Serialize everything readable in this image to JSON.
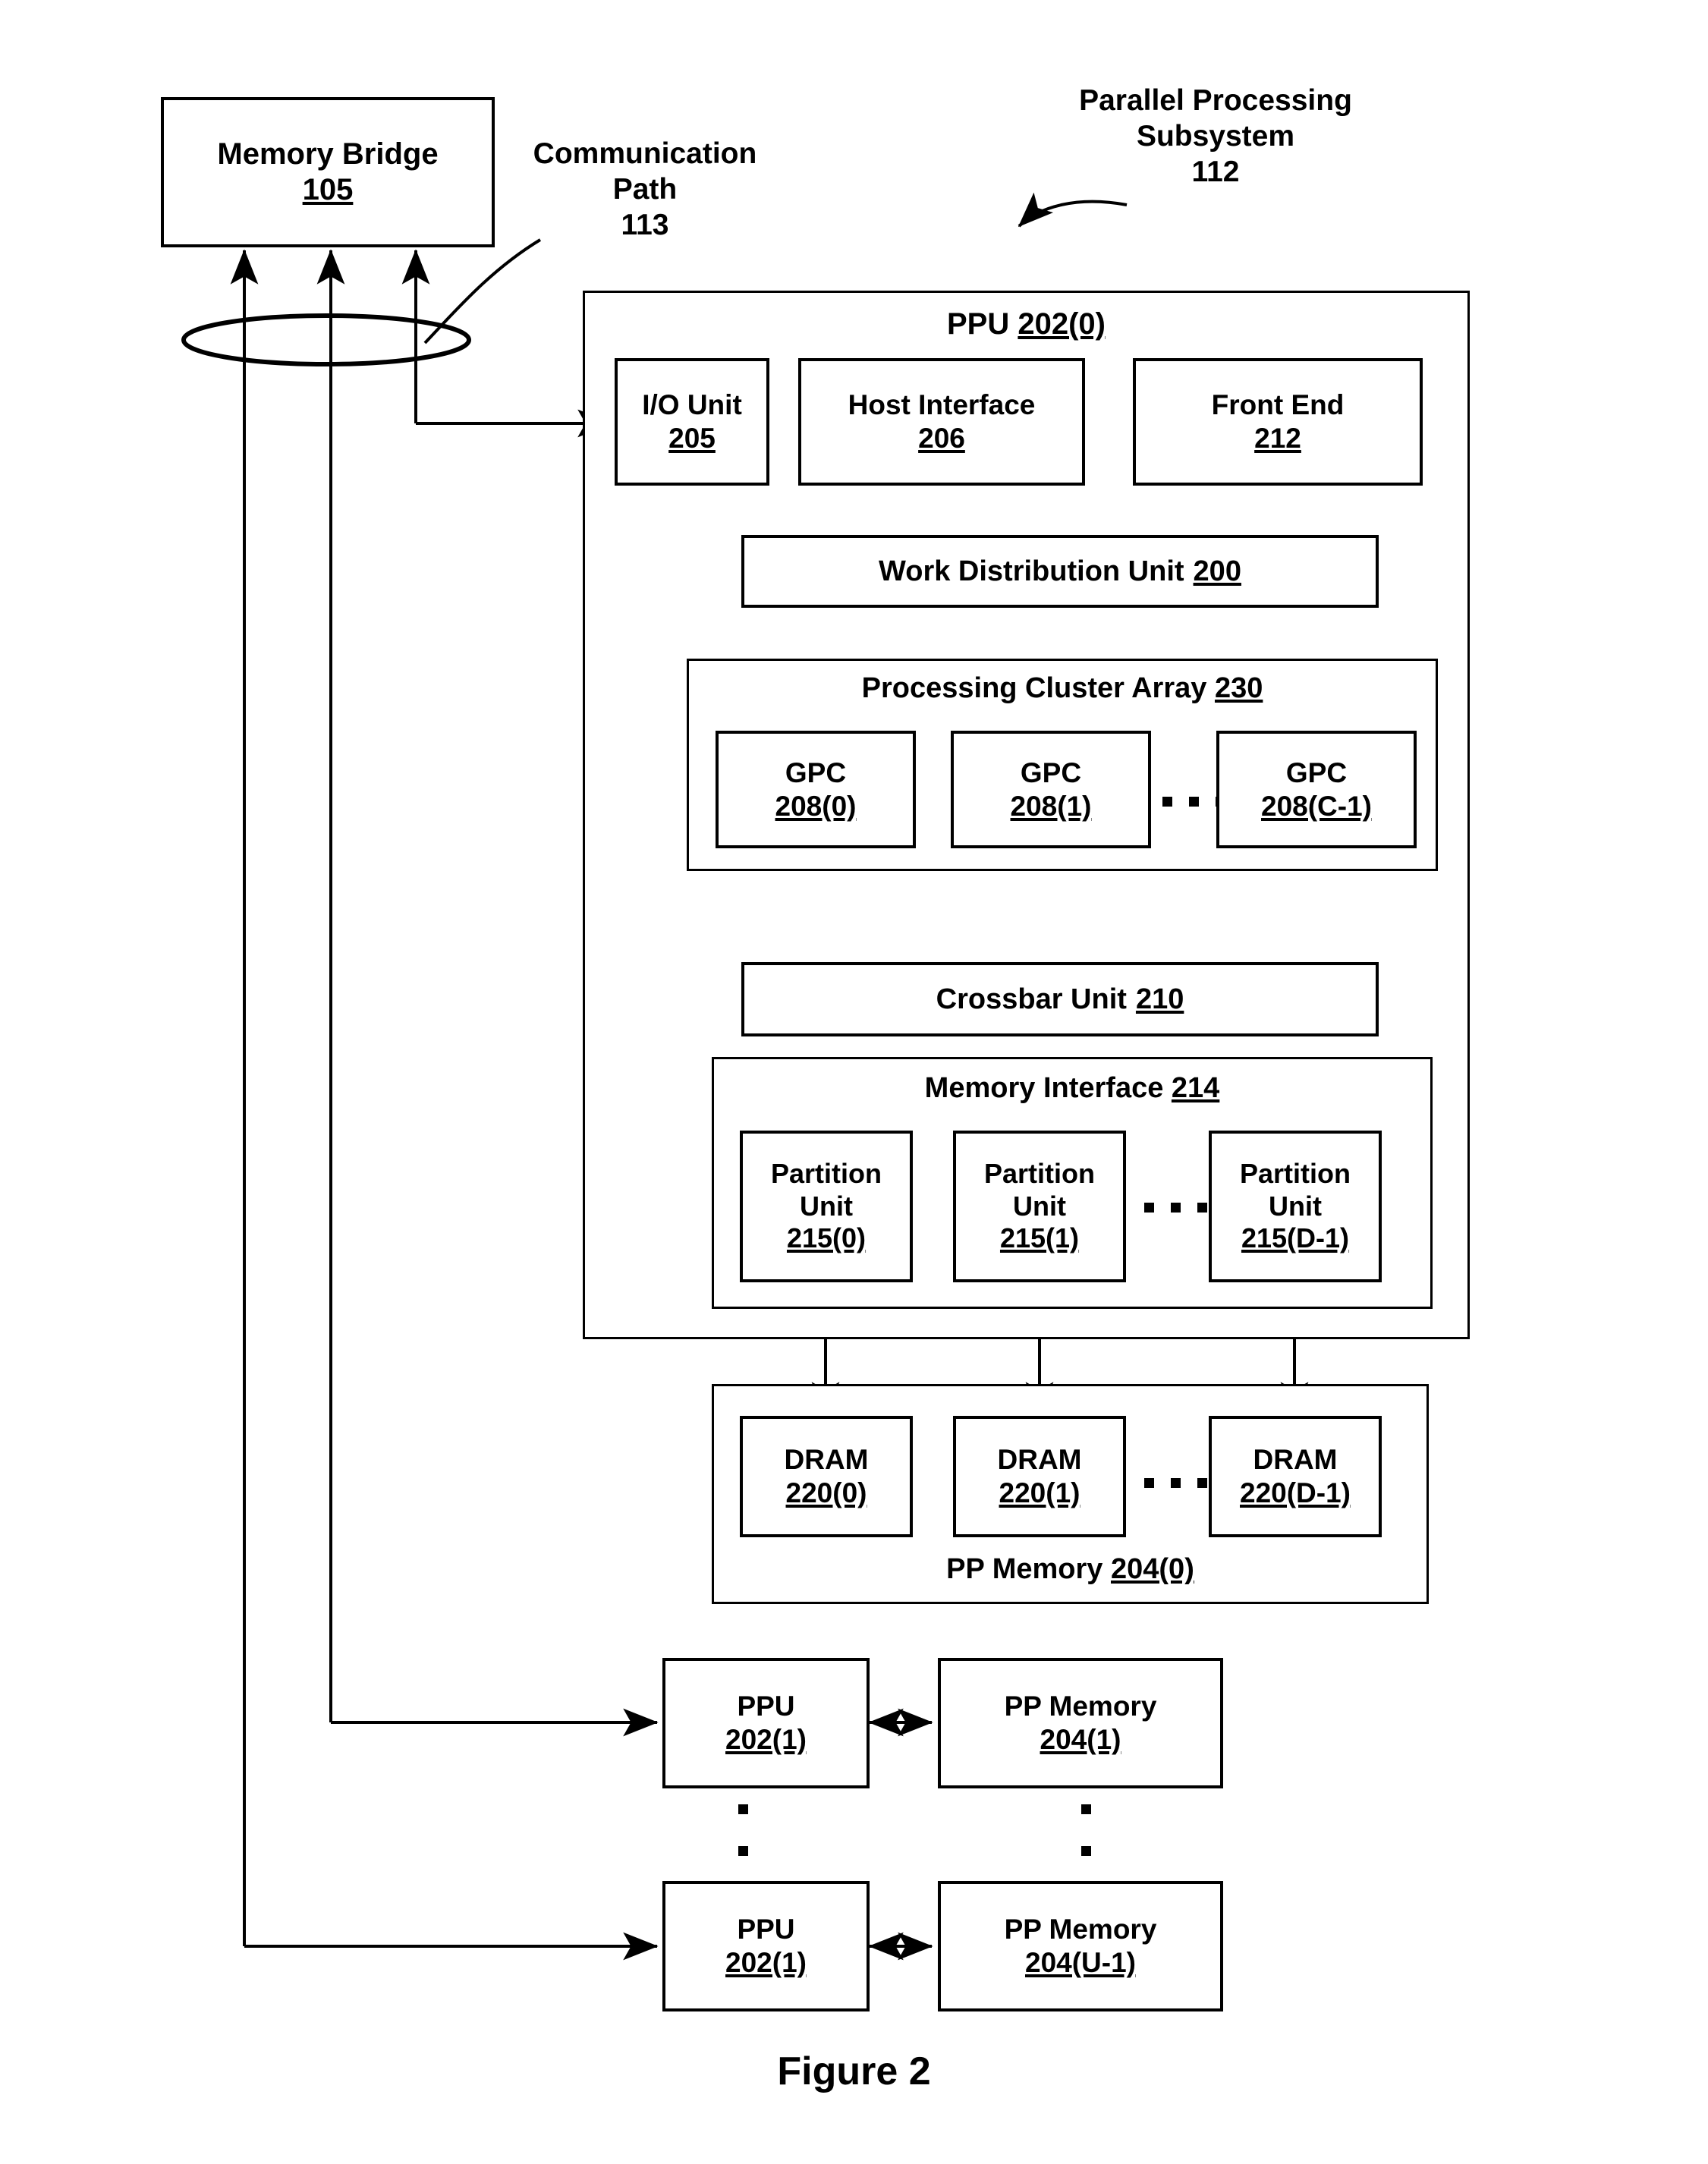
{
  "figure": {
    "caption": "Figure 2"
  },
  "annotations": {
    "communication_path": {
      "line1": "Communication",
      "line2": "Path",
      "ref": "113"
    },
    "parallel_processing_subsystem": {
      "line1": "Parallel Processing",
      "line2": "Subsystem",
      "ref": "112"
    }
  },
  "memory_bridge": {
    "label": "Memory Bridge",
    "ref": "105"
  },
  "ppu": {
    "title_label": "PPU",
    "title_ref": "202(0)",
    "io_unit": {
      "label": "I/O Unit",
      "ref": "205"
    },
    "host_interface": {
      "label": "Host Interface",
      "ref": "206"
    },
    "front_end": {
      "label": "Front End",
      "ref": "212"
    },
    "work_distribution_unit": {
      "label": "Work Distribution Unit",
      "ref": "200"
    },
    "processing_cluster_array": {
      "label": "Processing Cluster Array",
      "ref": "230",
      "gpcs": [
        {
          "label": "GPC",
          "ref": "208(0)"
        },
        {
          "label": "GPC",
          "ref": "208(1)"
        },
        {
          "label": "GPC",
          "ref": "208(C-1)"
        }
      ],
      "ellipsis": "..."
    },
    "crossbar_unit": {
      "label": "Crossbar Unit",
      "ref": "210"
    },
    "memory_interface": {
      "label": "Memory Interface",
      "ref": "214",
      "partitions": [
        {
          "line1": "Partition",
          "line2": "Unit",
          "ref": "215(0)"
        },
        {
          "line1": "Partition",
          "line2": "Unit",
          "ref": "215(1)"
        },
        {
          "line1": "Partition",
          "line2": "Unit",
          "ref": "215(D-1)"
        }
      ],
      "ellipsis": "..."
    }
  },
  "pp_memory_0": {
    "label": "PP Memory",
    "ref": "204(0)",
    "drams": [
      {
        "label": "DRAM",
        "ref": "220(0)"
      },
      {
        "label": "DRAM",
        "ref": "220(1)"
      },
      {
        "label": "DRAM",
        "ref": "220(D-1)"
      }
    ],
    "ellipsis": "..."
  },
  "additional_units": {
    "row1": {
      "ppu": {
        "label": "PPU",
        "ref": "202(1)"
      },
      "memory": {
        "label": "PP Memory",
        "ref": "204(1)"
      }
    },
    "row2": {
      "ppu": {
        "label": "PPU",
        "ref": "202(1)"
      },
      "memory": {
        "label": "PP Memory",
        "ref": "204(U-1)"
      }
    },
    "vertical_ellipsis": "·"
  },
  "colors": {
    "ink": "#000000",
    "paper": "#ffffff"
  }
}
